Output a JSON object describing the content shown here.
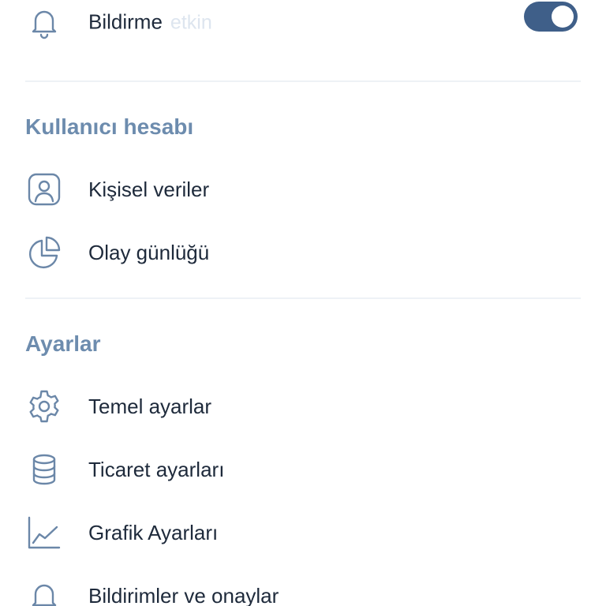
{
  "notification_row": {
    "label": "Bildirme",
    "status": "etkin",
    "icon": "bell-icon",
    "toggle_on": true,
    "accent": "#3f5f89"
  },
  "sections": [
    {
      "title": "Kullanıcı hesabı",
      "items": [
        {
          "label": "Kişisel veriler",
          "icon": "user-profile-icon"
        },
        {
          "label": "Olay günlüğü",
          "icon": "pie-chart-icon"
        }
      ]
    },
    {
      "title": "Ayarlar",
      "items": [
        {
          "label": "Temel ayarlar",
          "icon": "gear-icon"
        },
        {
          "label": "Ticaret ayarları",
          "icon": "database-icon"
        },
        {
          "label": "Grafik Ayarları",
          "icon": "line-chart-icon"
        },
        {
          "label": "Bildirimler ve onaylar",
          "icon": "bell-icon"
        }
      ]
    }
  ],
  "colors": {
    "section_title": "#6d8cae",
    "icon_stroke": "#6b87a8",
    "text": "#1e2a3b",
    "divider": "#eef2f6"
  }
}
